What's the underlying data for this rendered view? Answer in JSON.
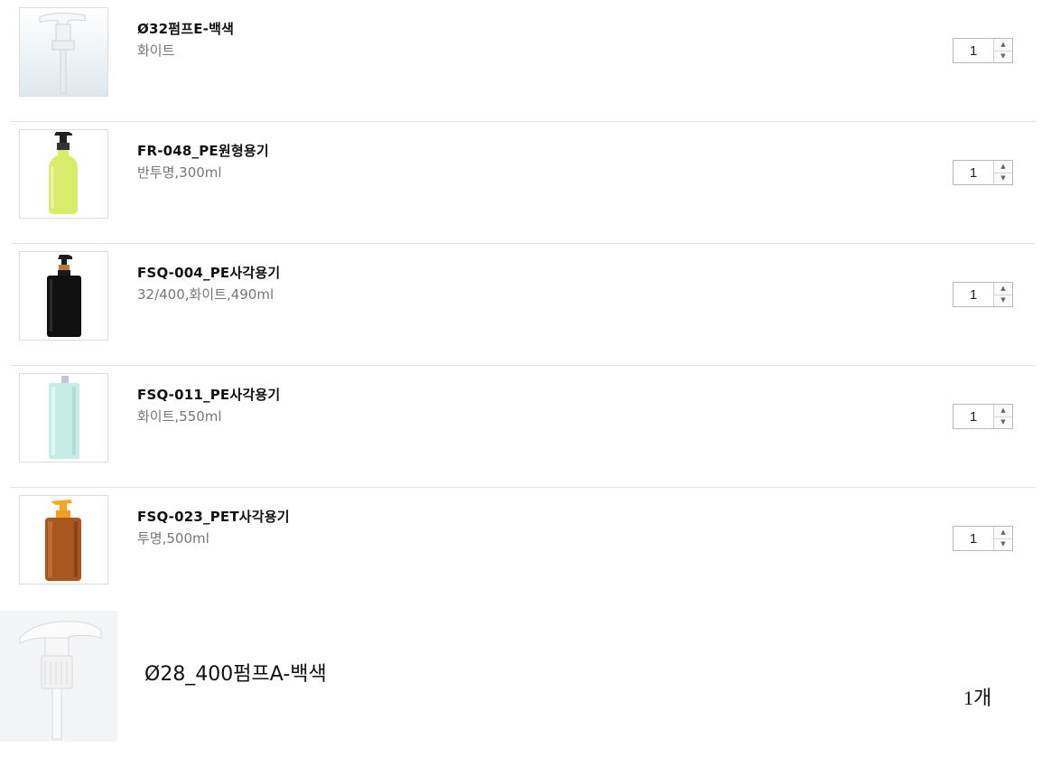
{
  "cart": {
    "items": [
      {
        "name": "Ø32펌프E-백색",
        "option": "화이트",
        "qty": "1",
        "image": "pump-dispenser"
      },
      {
        "name": "FR-048_PE원형용기",
        "option": "반투명,300ml",
        "qty": "1",
        "image": "lime-round-bottle"
      },
      {
        "name": "FSQ-004_PE사각용기",
        "option": "32/400,화이트,490ml",
        "qty": "1",
        "image": "black-square-bottle"
      },
      {
        "name": "FSQ-011_PE사각용기",
        "option": "화이트,550ml",
        "qty": "1",
        "image": "mint-square-bottle"
      },
      {
        "name": "FSQ-023_PET사각용기",
        "option": "투명,500ml",
        "qty": "1",
        "image": "amber-square-bottle"
      }
    ]
  },
  "summary": {
    "name": "Ø28_400펌프A-백색",
    "qty_text": "1개",
    "image": "white-pump-closeup"
  },
  "colors": {
    "divider": "#e3e3e3",
    "name_text": "#111111",
    "option_text": "#777777",
    "stepper_border": "#b8b8b8"
  }
}
